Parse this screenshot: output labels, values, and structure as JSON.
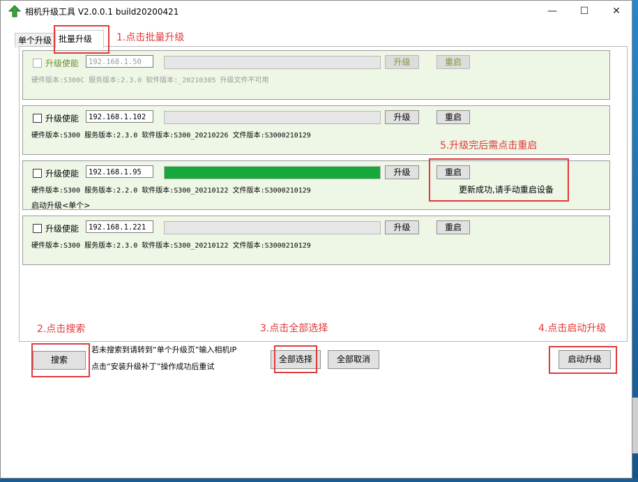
{
  "window": {
    "title": "相机升级工具 V2.0.0.1 build20200421"
  },
  "controls": {
    "minimize": "—",
    "maximize": "☐",
    "close": "✕"
  },
  "tabs": [
    {
      "label": "单个升级"
    },
    {
      "label": "批量升级"
    }
  ],
  "devices": [
    {
      "enable_label": "升级使能",
      "ip": "192.168.1.50",
      "upgrade_label": "升级",
      "reboot_label": "重启",
      "info": "硬件版本:S300C  服务版本:2.3.0  软件版本:_20210305  升级文件不可用",
      "progress": 0,
      "message": "",
      "sub": ""
    },
    {
      "enable_label": "升级使能",
      "ip": "192.168.1.102",
      "upgrade_label": "升级",
      "reboot_label": "重启",
      "info": "硬件版本:S300  服务版本:2.3.0  软件版本:S300_20210226  文件版本:S3000210129",
      "progress": 0,
      "message": "",
      "sub": ""
    },
    {
      "enable_label": "升级使能",
      "ip": "192.168.1.95",
      "upgrade_label": "升级",
      "reboot_label": "重启",
      "info": "硬件版本:S300  服务版本:2.2.0  软件版本:S300_20210122  文件版本:S3000210129",
      "progress": 100,
      "message": "更新成功,请手动重启设备",
      "sub": "启动升级<单个>"
    },
    {
      "enable_label": "升级使能",
      "ip": "192.168.1.221",
      "upgrade_label": "升级",
      "reboot_label": "重启",
      "info": "硬件版本:S300  服务版本:2.3.0  软件版本:S300_20210122  文件版本:S3000210129",
      "progress": 0,
      "message": "",
      "sub": ""
    }
  ],
  "bottom": {
    "search_label": "搜索",
    "hint_line1": "若未搜索到请转到“单个升级页”输入相机IP",
    "hint_line2": "点击“安装升级补丁”操作成功后重试",
    "select_all_label": "全部选择",
    "deselect_all_label": "全部取消",
    "start_label": "启动升级"
  },
  "annotations": {
    "step1": "1.点击批量升级",
    "step2": "2.点击搜索",
    "step3": "3.点击全部选择",
    "step4": "4.点击启动升级",
    "step5": "5.升级完后需点击重启",
    "color": "#e03a3a"
  }
}
